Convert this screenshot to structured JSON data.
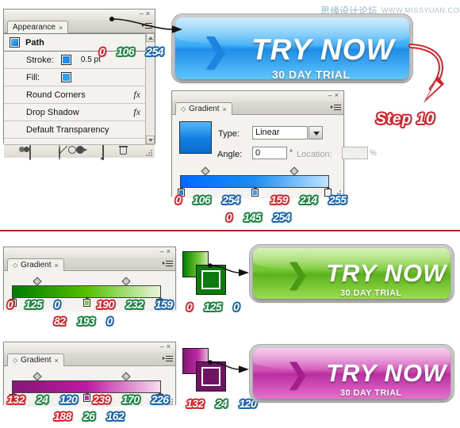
{
  "watermark": {
    "cn": "思缘设计论坛",
    "en": "WWW.MISSYUAN.COM"
  },
  "step": {
    "label": "Step 10"
  },
  "appearance_panel": {
    "tab_label": "Appearance",
    "tab_close": "×",
    "minimize": "–",
    "close": "×",
    "rows": [
      {
        "name": "Path",
        "type": "item",
        "swatch": "#1f8fef",
        "fx": ""
      },
      {
        "name": "Stroke:",
        "type": "stroke",
        "swatch": "#1f8fef",
        "width": "0.5 pt",
        "fx": ""
      },
      {
        "name": "Fill:",
        "type": "fill",
        "swatch": "#2aa3f5",
        "fx": ""
      },
      {
        "name": "Round Corners",
        "type": "effect",
        "fx": "fx"
      },
      {
        "name": "Drop Shadow",
        "type": "effect",
        "fx": "fx"
      },
      {
        "name": "Default Transparency",
        "type": "effect",
        "fx": ""
      }
    ],
    "footer_tools": [
      "toggle-visibility",
      "clear-appearance",
      "duplicate-item",
      "new-item",
      "delete-item"
    ],
    "stroke_rgb": {
      "r": "0",
      "g": "106",
      "b": "254"
    }
  },
  "gradient_panel_blue": {
    "tab_label": "Gradient",
    "tab_close": "×",
    "minimize": "–",
    "close": "×",
    "type_label": "Type:",
    "type_value": "Linear",
    "angle_label": "Angle:",
    "angle_value": "0",
    "degree_symbol": "°",
    "location_label": "Location:",
    "location_value": "",
    "percent_symbol": "%",
    "swatch_css": "linear-gradient(180deg,#55b8fb 0%,#0f7de0 55%,#0a6cc8 100%)",
    "bar_css": "linear-gradient(90deg,#006afe 0%,#1b8df3 50%,#bfe4ff 100%)",
    "stops": [
      {
        "pos": 0,
        "color": "#1a7fe8"
      },
      {
        "pos": 50,
        "color": "#2f9bf2"
      },
      {
        "pos": 100,
        "color": "#e3f3ff"
      }
    ],
    "midpoints": [
      22,
      78
    ]
  },
  "gradient_panel_green": {
    "tab_label": "Gradient",
    "tab_close": "×",
    "minimize": "–",
    "close": "×",
    "bar_css": "linear-gradient(90deg,#007d00 0%,#52c100 50%,#e8f6d8 100%)",
    "stops": [
      {
        "pos": 0,
        "color": "#1b8b1b"
      },
      {
        "pos": 50,
        "color": "#7fcb3a"
      },
      {
        "pos": 100,
        "color": "#f0f8e6"
      }
    ],
    "midpoints": [
      22,
      78
    ]
  },
  "gradient_panel_pink": {
    "tab_label": "Gradient",
    "tab_close": "×",
    "minimize": "–",
    "close": "×",
    "bar_css": "linear-gradient(90deg,#841878 0%,#bc1aa2 50%,#f6dcee 100%)",
    "stops": [
      {
        "pos": 0,
        "color": "#8a2b7c"
      },
      {
        "pos": 50,
        "color": "#c22aa8"
      },
      {
        "pos": 100,
        "color": "#f6e0f0"
      }
    ],
    "midpoints": [
      22,
      78
    ]
  },
  "buttons": {
    "blue": {
      "main": "TRY NOW",
      "sub": "30 DAY TRIAL",
      "chevron": "❯"
    },
    "green": {
      "main": "TRY NOW",
      "sub": "30 DAY TRIAL",
      "chevron": "❯"
    },
    "pink": {
      "main": "TRY NOW",
      "sub": "30 DAY TRIAL",
      "chevron": "❯"
    }
  },
  "rgb_groups": {
    "blue_stop_start": {
      "r": "0",
      "g": "106",
      "b": "254"
    },
    "blue_stop_end": {
      "r": "159",
      "g": "214",
      "b": "255"
    },
    "blue_stop_mid": {
      "r": "0",
      "g": "145",
      "b": "254"
    },
    "green_stop_start": {
      "r": "0",
      "g": "125",
      "b": "0"
    },
    "green_stop_end": {
      "r": "190",
      "g": "232",
      "b": "159"
    },
    "green_stop_mid": {
      "r": "82",
      "g": "193",
      "b": "0"
    },
    "green_stroke": {
      "r": "0",
      "g": "125",
      "b": "0"
    },
    "pink_stop_start": {
      "r": "132",
      "g": "24",
      "b": "120"
    },
    "pink_stop_end": {
      "r": "239",
      "g": "170",
      "b": "226"
    },
    "pink_stop_mid": {
      "r": "188",
      "g": "26",
      "b": "162"
    },
    "pink_stroke": {
      "r": "132",
      "g": "24",
      "b": "120"
    }
  },
  "swatch_pairs": {
    "green": {
      "fill_css": "linear-gradient(90deg,#007d00 0%,#6fc52a 60%,#cfe8b5 100%)",
      "stroke_color": "#0d7a0d"
    },
    "pink": {
      "fill_css": "linear-gradient(90deg,#841878 0%,#bf2aa6 60%,#e8b6da 100%)",
      "stroke_color": "#6f1464"
    }
  },
  "colors": {
    "divider": "#a32a1a",
    "red_outline": "#d81f26",
    "green_outline": "#15843c",
    "blue_outline": "#1663ad"
  }
}
